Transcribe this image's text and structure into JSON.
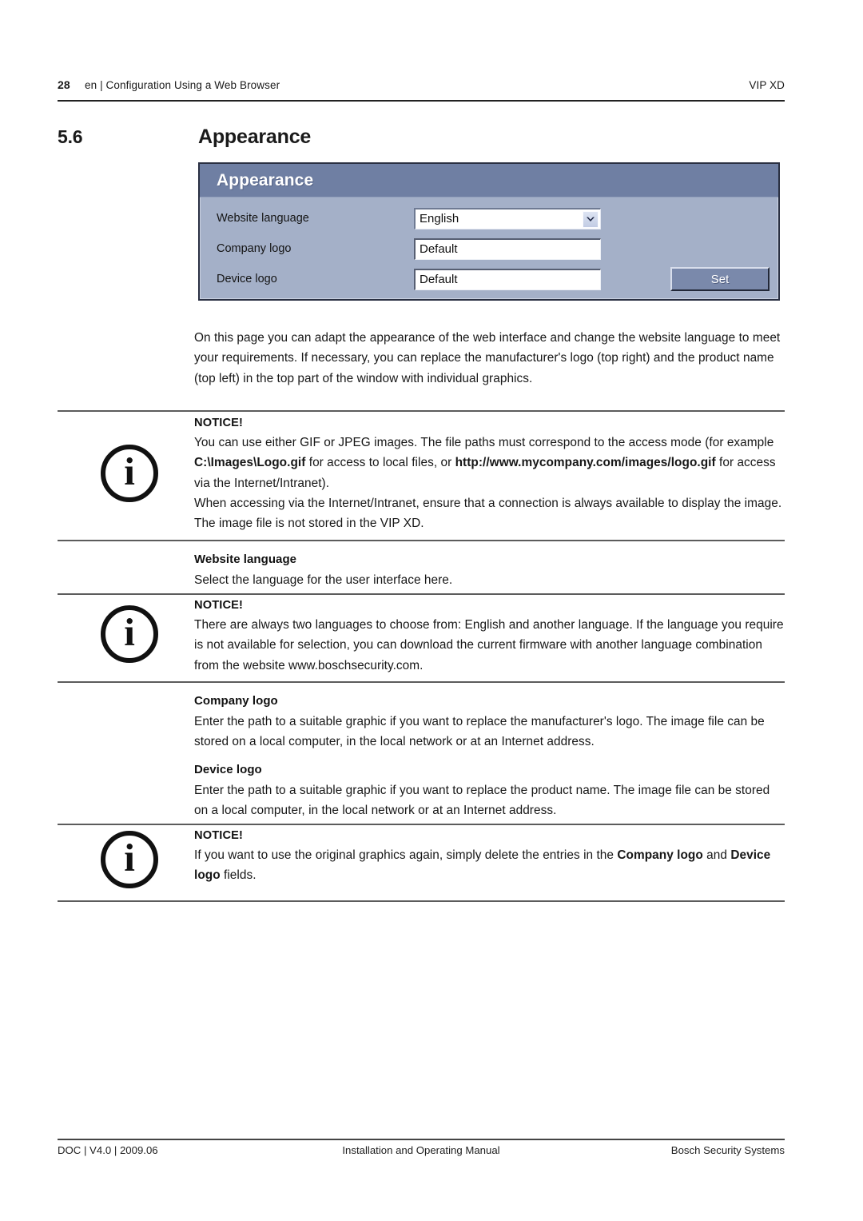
{
  "header": {
    "page_number": "28",
    "breadcrumb": "en | Configuration Using a Web Browser",
    "product": "VIP XD"
  },
  "section": {
    "number": "5.6",
    "title": "Appearance"
  },
  "ui_panel": {
    "title": "Appearance",
    "rows": [
      {
        "label": "Website language",
        "type": "select",
        "value": "English",
        "icon": "chevron-down-icon"
      },
      {
        "label": "Company logo",
        "type": "text",
        "value": "Default"
      },
      {
        "label": "Device logo",
        "type": "text",
        "value": "Default"
      }
    ],
    "set_button": "Set"
  },
  "intro": "On this page you can adapt the appearance of the web interface and change the website language to meet your requirements. If necessary, you can replace the manufacturer's logo (top right) and the product name (top left) in the top part of the window with individual graphics.",
  "notice_label": "NOTICE!",
  "notice_1": {
    "line_a_plain": "You can use either GIF or JPEG images. The file paths must correspond to the access mode (for example ",
    "bold_1": "C:\\Images\\Logo.gif",
    "mid_plain": " for access to local files, or ",
    "bold_2": "http://www.mycompany.com/images/logo.gif",
    "tail_plain": " for access via the Internet/Intranet).",
    "para_2": "When accessing via the Internet/Intranet, ensure that a connection is always available to display the image. The image file is not stored in the VIP XD."
  },
  "website_language": {
    "heading": "Website language",
    "body": "Select the language for the user interface here."
  },
  "notice_2": {
    "body": "There are always two languages to choose from: English and another language. If the language you require is not available for selection, you can download the current firmware with another language combination from the website www.boschsecurity.com."
  },
  "company_logo": {
    "heading": "Company logo",
    "body": "Enter the path to a suitable graphic if you want to replace the manufacturer's logo. The image file can be stored on a local computer, in the local network or at an Internet address."
  },
  "device_logo": {
    "heading": "Device logo",
    "body": "Enter the path to a suitable graphic if you want to replace the product name. The image file can be stored on a local computer, in the local network or at an Internet address."
  },
  "notice_3": {
    "lead": "If you want to use the original graphics again, simply delete the entries in the ",
    "bold_1": "Company logo",
    "mid": " and ",
    "bold_2": "Device logo",
    "tail": " fields."
  },
  "info_icon_glyph": "i",
  "footer": {
    "left": "DOC | V4.0 | 2009.06",
    "center": "Installation and Operating Manual",
    "right": "Bosch Security Systems"
  },
  "colors": {
    "panel_titlebar": "#6f7fa3",
    "panel_body": "#a4b0c8",
    "panel_border": "#2a3042",
    "button_face": "#7a89ab",
    "rule": "#5c5c5c"
  }
}
